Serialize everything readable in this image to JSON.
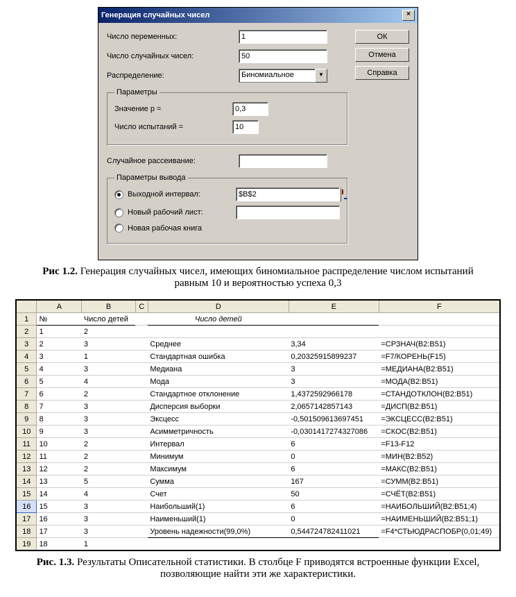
{
  "dialog": {
    "title": "Генерация случайных чисел",
    "close_x": "×",
    "num_vars_label": "Число переменных:",
    "num_vars_value": "1",
    "num_rand_label": "Число случайных чисел:",
    "num_rand_value": "50",
    "dist_label": "Распределение:",
    "dist_value": "Биномиальное",
    "params_legend": "Параметры",
    "p_label": "Значение p =",
    "p_value": "0,3",
    "trials_label": "Число испытаний =",
    "trials_value": "10",
    "seed_label": "Случайное рассеивание:",
    "seed_value": "",
    "output_legend": "Параметры вывода",
    "out_range_label": "Выходной интервал:",
    "out_range_value": "$B$2",
    "new_sheet_label": "Новый рабочий лист:",
    "new_book_label": "Новая рабочая книга",
    "btn_ok": "ОК",
    "btn_cancel": "Отмена",
    "btn_help": "Справка"
  },
  "caption1_bold": "Рис 1.2.",
  "caption1_text": " Генерация случайных чисел, имеющих биномиальное распределение числом испытаний равным 10 и вероятностью успеха 0,3",
  "sheet": {
    "cols": [
      "",
      "A",
      "B",
      "C",
      "D",
      "E",
      "F"
    ],
    "header_row": {
      "A": "№",
      "B": "Число детей",
      "D_italic": "Число детей"
    },
    "rows": [
      {
        "n": "2",
        "A": "1",
        "B": "2",
        "D": "",
        "E": "",
        "F": ""
      },
      {
        "n": "3",
        "A": "2",
        "B": "3",
        "D": "Среднее",
        "E": "3,34",
        "F": "=СРЗНАЧ(B2:B51)"
      },
      {
        "n": "4",
        "A": "3",
        "B": "1",
        "D": "Стандартная ошибка",
        "E": "0,20325915899237",
        "F": "=F7/КОРЕНЬ(F15)"
      },
      {
        "n": "5",
        "A": "4",
        "B": "3",
        "D": "Медиана",
        "E": "3",
        "F": "=МЕДИАНА(B2:B51)"
      },
      {
        "n": "6",
        "A": "5",
        "B": "4",
        "D": "Мода",
        "E": "3",
        "F": "=МОДА(B2:B51)"
      },
      {
        "n": "7",
        "A": "6",
        "B": "2",
        "D": "Стандартное отклонение",
        "E": "1,4372592966178",
        "F": "=СТАНДОТКЛОН(B2:B51)"
      },
      {
        "n": "8",
        "A": "7",
        "B": "3",
        "D": "Дисперсия выборки",
        "E": "2,0657142857143",
        "F": "=ДИСП(B2:B51)"
      },
      {
        "n": "9",
        "A": "8",
        "B": "3",
        "D": "Эксцесс",
        "E": "-0,501509613697451",
        "F": "=ЭКСЦЕСС(B2:B51)"
      },
      {
        "n": "10",
        "A": "9",
        "B": "3",
        "D": "Асимметричность",
        "E": "-0,0301417274327086",
        "F": "=СКОС(B2:B51)"
      },
      {
        "n": "11",
        "A": "10",
        "B": "2",
        "D": "Интервал",
        "E": "6",
        "F": "=F13-F12"
      },
      {
        "n": "12",
        "A": "11",
        "B": "2",
        "D": "Минимум",
        "E": "0",
        "F": "=МИН(B2:B52)"
      },
      {
        "n": "13",
        "A": "12",
        "B": "2",
        "D": "Максимум",
        "E": "6",
        "F": "=МАКС(B2:B51)"
      },
      {
        "n": "14",
        "A": "13",
        "B": "5",
        "D": "Сумма",
        "E": "167",
        "F": "=СУММ(B2:B51)"
      },
      {
        "n": "15",
        "A": "14",
        "B": "4",
        "D": "Счет",
        "E": "50",
        "F": "=СЧЁТ(B2:B51)"
      },
      {
        "n": "16",
        "A": "15",
        "B": "3",
        "D": "Наибольший(1)",
        "E": "6",
        "F": "=НАИБОЛЬШИЙ(B2:B51;4)",
        "sel": true
      },
      {
        "n": "17",
        "A": "16",
        "B": "3",
        "D": "Наименьший(1)",
        "E": "0",
        "F": "=НАИМЕНЬШИЙ(B2:B51;1)"
      },
      {
        "n": "18",
        "A": "17",
        "B": "3",
        "D": "Уровень надежности(99,0%)",
        "E": "0,544724782411021",
        "F": "=F4*СТЬЮДРАСПОБР(0,01;49)"
      },
      {
        "n": "19",
        "A": "18",
        "B": "1",
        "D": "",
        "E": "",
        "F": ""
      }
    ]
  },
  "caption2_bold": "Рис. 1.3.",
  "caption2_text": " Результаты Описательной статистики. В столбце F приводятся встроенные функции Excel, позволяющие найти эти же характеристики."
}
